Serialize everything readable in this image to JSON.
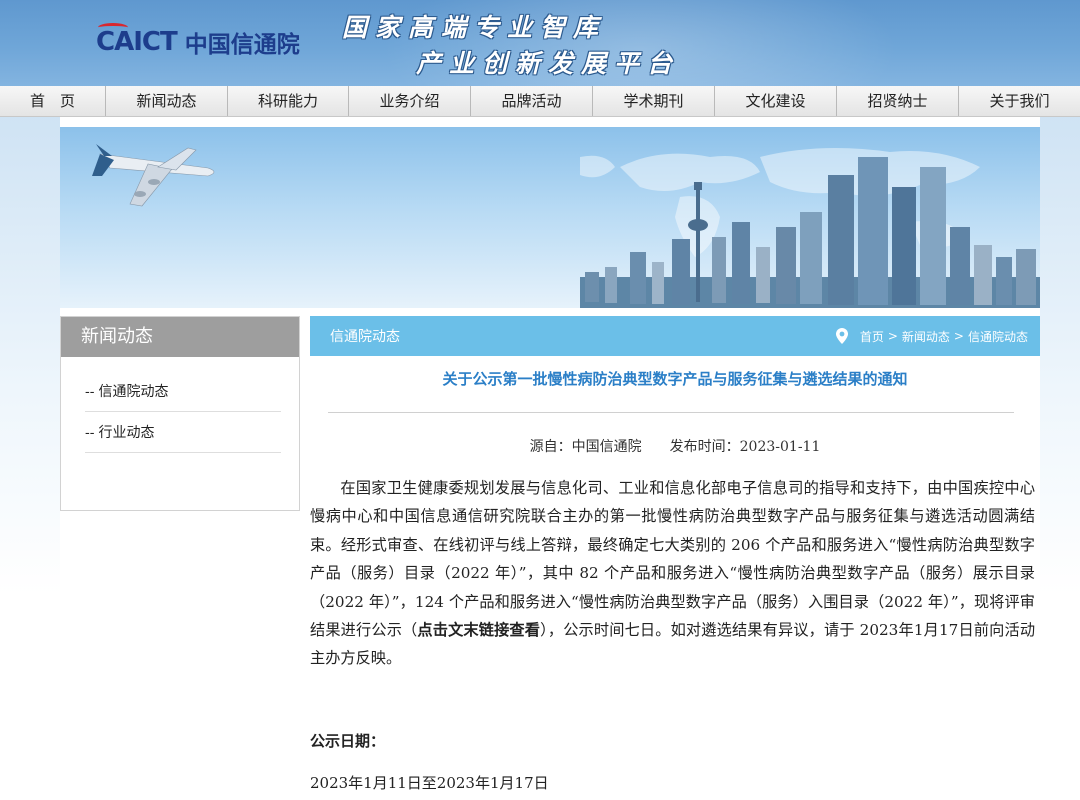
{
  "header": {
    "logo_en": "CAICT",
    "logo_cn": "中国信通院",
    "slogan_line1": "国家高端专业智库",
    "slogan_line2": "产业创新发展平台"
  },
  "nav": {
    "items": [
      "首　页",
      "新闻动态",
      "科研能力",
      "业务介绍",
      "品牌活动",
      "学术期刊",
      "文化建设",
      "招贤纳士",
      "关于我们"
    ]
  },
  "sidebar": {
    "title": "新闻动态",
    "items": [
      {
        "dash": "--",
        "label": "信通院动态"
      },
      {
        "dash": "--",
        "label": "行业动态"
      }
    ]
  },
  "main": {
    "bar_title": "信通院动态",
    "breadcrumb": [
      "首页",
      "新闻动态",
      "信通院动态"
    ],
    "breadcrumb_sep": ">",
    "article_title": "关于公示第一批慢性病防治典型数字产品与服务征集与遴选结果的通知",
    "source": "源自：中国信通院",
    "publish_time": "发布时间：2023-01-11",
    "body_before": "在国家卫生健康委规划发展与信息化司、工业和信息化部电子信息司的指导和支持下，由中国疾控中心慢病中心和中国信息通信研究院联合主办的第一批慢性病防治典型数字产品与服务征集与遴选活动圆满结束。经形式审查、在线初评与线上答辩，最终确定七大类别的 206 个产品和服务进入“慢性病防治典型数字产品（服务）目录（2022 年）”，其中 82 个产品和服务进入“慢性病防治典型数字产品（服务）展示目录（2022 年）”，124 个产品和服务进入“慢性病防治典型数字产品（服务）入围目录（2022 年）”，现将评审结果进行公示（",
    "body_bold": "点击文末链接查看",
    "body_after": "），公示时间七日。如对遴选结果有异议，请于 2023年1月17日前向活动主办方反映。",
    "date_label": "公示日期：",
    "date_range": "2023年1月11日至2023年1月17日"
  },
  "colors": {
    "header_blue": "#6fa6d8",
    "logo_blue": "#1d3d8c",
    "bar_blue": "#6bbfe8",
    "title_blue": "#2b7fc7",
    "sidebar_gray": "#9e9e9e"
  },
  "icons": {
    "breadcrumb": "location-pin-icon"
  }
}
